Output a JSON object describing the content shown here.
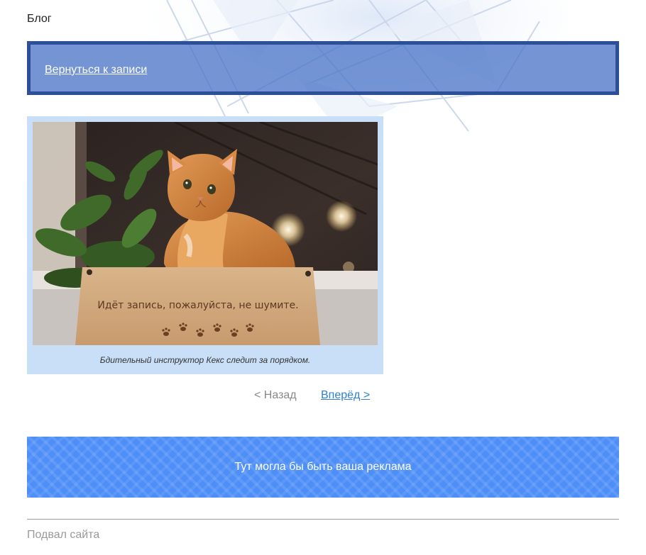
{
  "header": {
    "site_title": "Блог"
  },
  "back_bar": {
    "link_label": "Вернуться к записи"
  },
  "photo": {
    "sign_text": "Идёт запись, пожалуйста, не шумите.",
    "caption": "Бдительный инструктор Кекс следит за порядком."
  },
  "pager": {
    "prev_label": "< Назад",
    "next_label": "Вперёд >"
  },
  "ad": {
    "text": "Тут могла бы быть ваша реклама"
  },
  "footer": {
    "text": "Подвал сайта"
  },
  "colors": {
    "back_bar_border": "#2c4f97",
    "back_bar_fill": "#4d76c8",
    "photo_frame": "#c9dff7",
    "ad_banner": "#4d8ef7",
    "link": "#2d7fd0"
  }
}
